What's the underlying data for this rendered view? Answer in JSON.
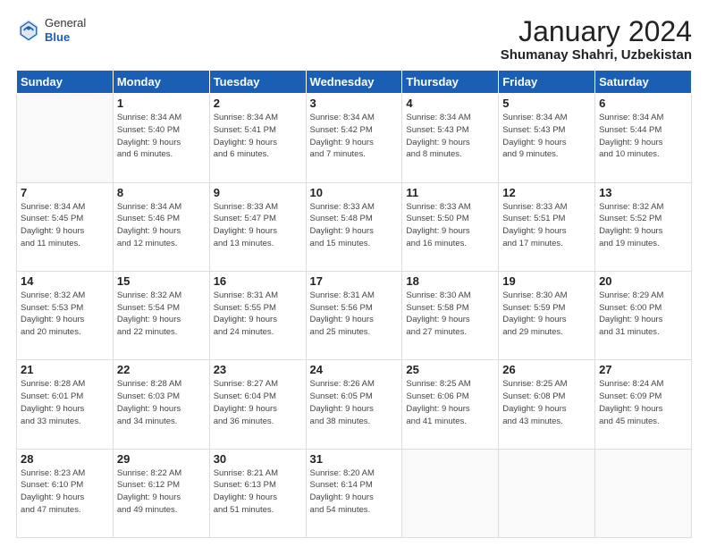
{
  "header": {
    "logo_general": "General",
    "logo_blue": "Blue",
    "title": "January 2024",
    "subtitle": "Shumanay Shahri, Uzbekistan"
  },
  "weekdays": [
    "Sunday",
    "Monday",
    "Tuesday",
    "Wednesday",
    "Thursday",
    "Friday",
    "Saturday"
  ],
  "weeks": [
    [
      {
        "day": "",
        "info": ""
      },
      {
        "day": "1",
        "info": "Sunrise: 8:34 AM\nSunset: 5:40 PM\nDaylight: 9 hours\nand 6 minutes."
      },
      {
        "day": "2",
        "info": "Sunrise: 8:34 AM\nSunset: 5:41 PM\nDaylight: 9 hours\nand 6 minutes."
      },
      {
        "day": "3",
        "info": "Sunrise: 8:34 AM\nSunset: 5:42 PM\nDaylight: 9 hours\nand 7 minutes."
      },
      {
        "day": "4",
        "info": "Sunrise: 8:34 AM\nSunset: 5:43 PM\nDaylight: 9 hours\nand 8 minutes."
      },
      {
        "day": "5",
        "info": "Sunrise: 8:34 AM\nSunset: 5:43 PM\nDaylight: 9 hours\nand 9 minutes."
      },
      {
        "day": "6",
        "info": "Sunrise: 8:34 AM\nSunset: 5:44 PM\nDaylight: 9 hours\nand 10 minutes."
      }
    ],
    [
      {
        "day": "7",
        "info": "Sunrise: 8:34 AM\nSunset: 5:45 PM\nDaylight: 9 hours\nand 11 minutes."
      },
      {
        "day": "8",
        "info": "Sunrise: 8:34 AM\nSunset: 5:46 PM\nDaylight: 9 hours\nand 12 minutes."
      },
      {
        "day": "9",
        "info": "Sunrise: 8:33 AM\nSunset: 5:47 PM\nDaylight: 9 hours\nand 13 minutes."
      },
      {
        "day": "10",
        "info": "Sunrise: 8:33 AM\nSunset: 5:48 PM\nDaylight: 9 hours\nand 15 minutes."
      },
      {
        "day": "11",
        "info": "Sunrise: 8:33 AM\nSunset: 5:50 PM\nDaylight: 9 hours\nand 16 minutes."
      },
      {
        "day": "12",
        "info": "Sunrise: 8:33 AM\nSunset: 5:51 PM\nDaylight: 9 hours\nand 17 minutes."
      },
      {
        "day": "13",
        "info": "Sunrise: 8:32 AM\nSunset: 5:52 PM\nDaylight: 9 hours\nand 19 minutes."
      }
    ],
    [
      {
        "day": "14",
        "info": "Sunrise: 8:32 AM\nSunset: 5:53 PM\nDaylight: 9 hours\nand 20 minutes."
      },
      {
        "day": "15",
        "info": "Sunrise: 8:32 AM\nSunset: 5:54 PM\nDaylight: 9 hours\nand 22 minutes."
      },
      {
        "day": "16",
        "info": "Sunrise: 8:31 AM\nSunset: 5:55 PM\nDaylight: 9 hours\nand 24 minutes."
      },
      {
        "day": "17",
        "info": "Sunrise: 8:31 AM\nSunset: 5:56 PM\nDaylight: 9 hours\nand 25 minutes."
      },
      {
        "day": "18",
        "info": "Sunrise: 8:30 AM\nSunset: 5:58 PM\nDaylight: 9 hours\nand 27 minutes."
      },
      {
        "day": "19",
        "info": "Sunrise: 8:30 AM\nSunset: 5:59 PM\nDaylight: 9 hours\nand 29 minutes."
      },
      {
        "day": "20",
        "info": "Sunrise: 8:29 AM\nSunset: 6:00 PM\nDaylight: 9 hours\nand 31 minutes."
      }
    ],
    [
      {
        "day": "21",
        "info": "Sunrise: 8:28 AM\nSunset: 6:01 PM\nDaylight: 9 hours\nand 33 minutes."
      },
      {
        "day": "22",
        "info": "Sunrise: 8:28 AM\nSunset: 6:03 PM\nDaylight: 9 hours\nand 34 minutes."
      },
      {
        "day": "23",
        "info": "Sunrise: 8:27 AM\nSunset: 6:04 PM\nDaylight: 9 hours\nand 36 minutes."
      },
      {
        "day": "24",
        "info": "Sunrise: 8:26 AM\nSunset: 6:05 PM\nDaylight: 9 hours\nand 38 minutes."
      },
      {
        "day": "25",
        "info": "Sunrise: 8:25 AM\nSunset: 6:06 PM\nDaylight: 9 hours\nand 41 minutes."
      },
      {
        "day": "26",
        "info": "Sunrise: 8:25 AM\nSunset: 6:08 PM\nDaylight: 9 hours\nand 43 minutes."
      },
      {
        "day": "27",
        "info": "Sunrise: 8:24 AM\nSunset: 6:09 PM\nDaylight: 9 hours\nand 45 minutes."
      }
    ],
    [
      {
        "day": "28",
        "info": "Sunrise: 8:23 AM\nSunset: 6:10 PM\nDaylight: 9 hours\nand 47 minutes."
      },
      {
        "day": "29",
        "info": "Sunrise: 8:22 AM\nSunset: 6:12 PM\nDaylight: 9 hours\nand 49 minutes."
      },
      {
        "day": "30",
        "info": "Sunrise: 8:21 AM\nSunset: 6:13 PM\nDaylight: 9 hours\nand 51 minutes."
      },
      {
        "day": "31",
        "info": "Sunrise: 8:20 AM\nSunset: 6:14 PM\nDaylight: 9 hours\nand 54 minutes."
      },
      {
        "day": "",
        "info": ""
      },
      {
        "day": "",
        "info": ""
      },
      {
        "day": "",
        "info": ""
      }
    ]
  ]
}
